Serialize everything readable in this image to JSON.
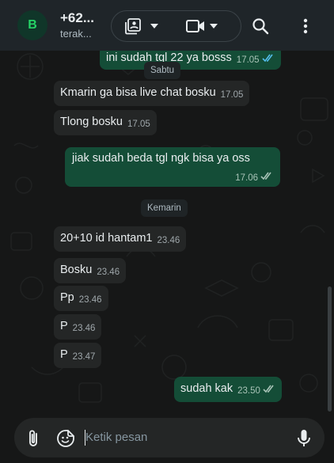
{
  "header": {
    "avatar_initial": "B",
    "contact_name": "+62...",
    "contact_status": "terak..."
  },
  "icons": {
    "attach": "paperclip-icon",
    "emoji": "sticker-icon",
    "mic": "microphone-icon",
    "search": "search-icon",
    "menu": "kebab-menu-icon",
    "video": "video-camera-icon",
    "gallery": "photo-library-icon"
  },
  "chat": {
    "day_chips": [
      "Sabtu",
      "Kemarin"
    ],
    "messages": [
      {
        "text": "ini sudah tgl 22 ya bosss",
        "time": "17.05",
        "dir": "out",
        "status": "read"
      },
      {
        "text": "Kmarin ga bisa live chat bosku",
        "time": "17.05",
        "dir": "in"
      },
      {
        "text": "Tlong bosku",
        "time": "17.05",
        "dir": "in"
      },
      {
        "text": "jiak sudah beda tgl ngk bisa ya oss",
        "time": "17.06",
        "dir": "out",
        "status": "delivered"
      },
      {
        "text": "20+10 id hantam1",
        "time": "23.46",
        "dir": "in"
      },
      {
        "text": "Bosku",
        "time": "23.46",
        "dir": "in"
      },
      {
        "text": "Pp",
        "time": "23.46",
        "dir": "in"
      },
      {
        "text": "P",
        "time": "23.46",
        "dir": "in"
      },
      {
        "text": "P",
        "time": "23.47",
        "dir": "in"
      },
      {
        "text": "sudah kak",
        "time": "23.50",
        "dir": "out",
        "status": "delivered"
      }
    ]
  },
  "composer": {
    "placeholder": "Ketik pesan"
  },
  "colors": {
    "outgoing_bubble": "#144d37",
    "incoming_bubble": "#242626",
    "read_tick": "#53bdeb",
    "delivered_tick": "#a8c3b7",
    "avatar_text": "#25d366"
  }
}
